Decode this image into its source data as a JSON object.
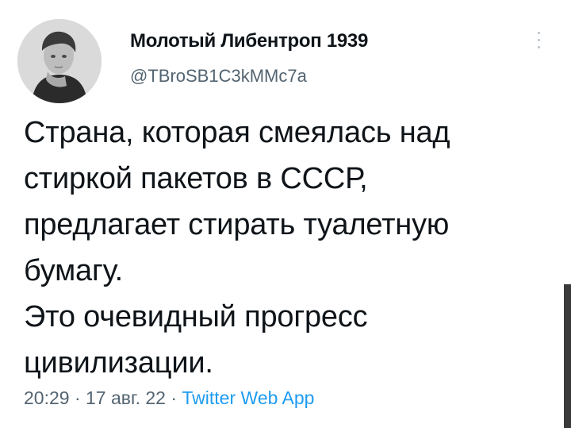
{
  "tweet": {
    "author": {
      "display_name": "Молотый Либентроп 1939",
      "handle": "@TBroSB1C3kMMc7a",
      "avatar_icon": "user-avatar-photo"
    },
    "text_lines": [
      "Страна, которая смеялась над",
      "стиркой пакетов в СССР,",
      "предлагает стирать туалетную",
      "бумагу.",
      "Это очевидный прогресс",
      "цивилизации."
    ],
    "meta": {
      "time": "20:29",
      "separator": " · ",
      "date": "17 авг. 22",
      "source": "Twitter Web App"
    },
    "more_icon": "more-vertical-icon"
  },
  "colors": {
    "text": "#0f1419",
    "secondary": "#536471",
    "link": "#1d9bf0",
    "background": "#ffffff"
  }
}
